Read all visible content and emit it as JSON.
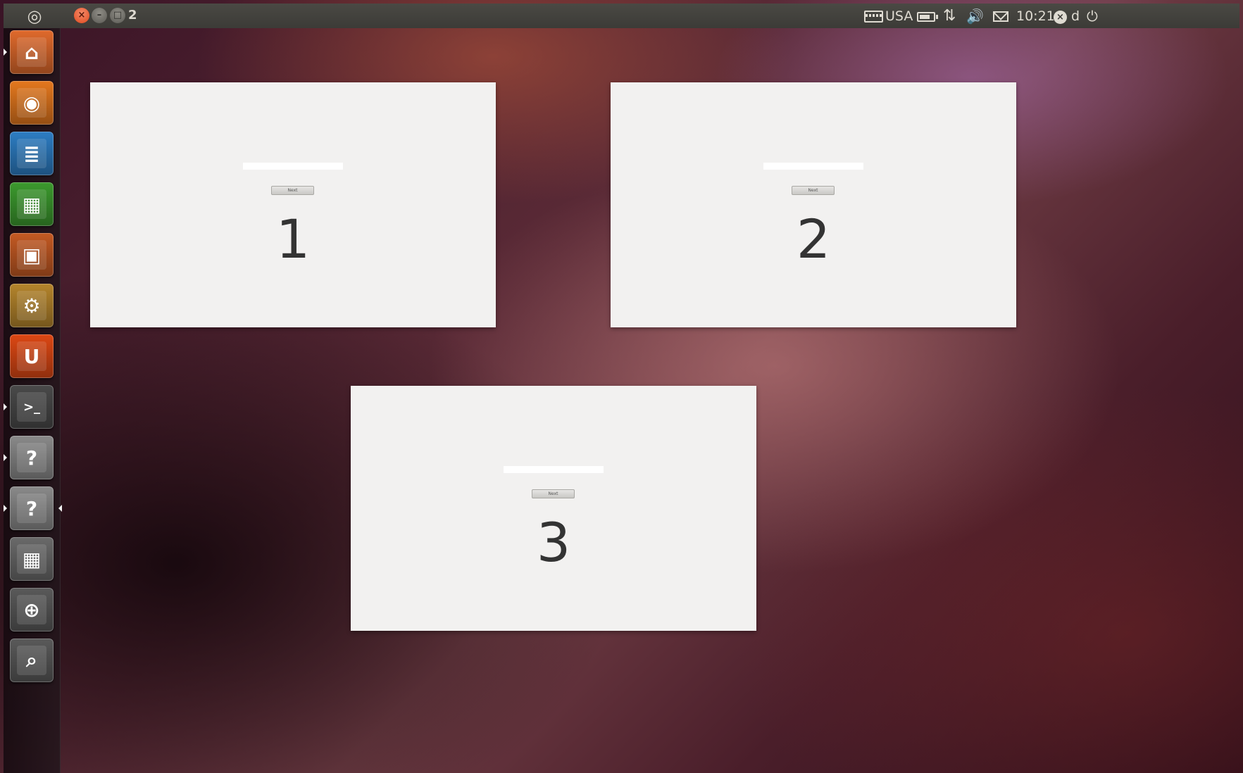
{
  "top_panel": {
    "window_title": "2",
    "window_buttons": {
      "close_glyph": "×",
      "minimize_glyph": "–",
      "maximize_glyph": "□"
    },
    "indicators": {
      "keyboard_icon": "keyboard-icon",
      "keyboard_layout": "USA",
      "battery_icon": "battery-icon",
      "network_icon": "network-updown-icon",
      "network_glyph": "⇅",
      "sound_icon": "speaker-icon",
      "sound_glyph": "🔊",
      "mail_icon": "mail-icon",
      "clock": "10:21",
      "user_status_glyph": "×",
      "user_name": "d",
      "power_glyph": "⏻"
    },
    "bfb_glyph": "◎"
  },
  "launcher": {
    "items": [
      {
        "name": "home-folder",
        "icon": "folder-home-icon",
        "glyph": "⌂",
        "color": "#e06a2c"
      },
      {
        "name": "firefox",
        "icon": "firefox-icon",
        "glyph": "◉",
        "color": "#e4781e"
      },
      {
        "name": "libreoffice-writer",
        "icon": "writer-icon",
        "glyph": "≣",
        "color": "#2d7dc3"
      },
      {
        "name": "libreoffice-calc",
        "icon": "calc-icon",
        "glyph": "▦",
        "color": "#3c9a2e"
      },
      {
        "name": "libreoffice-impress",
        "icon": "impress-icon",
        "glyph": "▣",
        "color": "#c45a23"
      },
      {
        "name": "software-center",
        "icon": "software-center-icon",
        "glyph": "⚙",
        "color": "#b5852c"
      },
      {
        "name": "ubuntu-one",
        "icon": "ubuntu-one-icon",
        "glyph": "U",
        "color": "#dd4814"
      },
      {
        "name": "terminal",
        "icon": "terminal-icon",
        "glyph": ">_",
        "color": "#4a4a4a"
      },
      {
        "name": "unknown-app-1",
        "icon": "question-icon",
        "glyph": "?",
        "color": "#8a8a8a"
      },
      {
        "name": "unknown-app-2",
        "icon": "question-icon",
        "glyph": "?",
        "color": "#8a8a8a"
      },
      {
        "name": "workspace-switcher",
        "icon": "workspace-switcher-icon",
        "glyph": "▦",
        "color": "#6a6a6a"
      },
      {
        "name": "zoom-in",
        "icon": "zoom-in-icon",
        "glyph": "⊕",
        "color": "#5a5a5a"
      },
      {
        "name": "zoom-lens",
        "icon": "magnifier-icon",
        "glyph": "⌕",
        "color": "#5a5a5a"
      }
    ]
  },
  "workspaces": [
    {
      "number": "1",
      "button_label": "Next"
    },
    {
      "number": "2",
      "button_label": "Next"
    },
    {
      "number": "3",
      "button_label": "Next"
    }
  ]
}
